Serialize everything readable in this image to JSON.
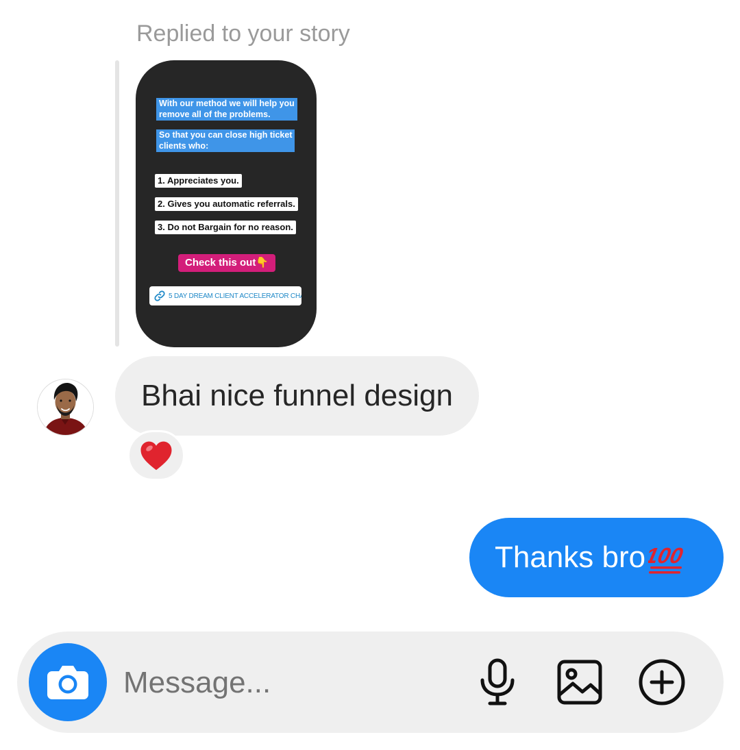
{
  "reply_header": {
    "label": "Replied to your story"
  },
  "story": {
    "highlight_1": [
      "With our method we will help you",
      "remove all of the problems."
    ],
    "highlight_2": [
      "So that you can close high ticket",
      "clients who:"
    ],
    "list": [
      "1. Appreciates you.",
      "2. Gives you automatic referrals.",
      "3. Do not Bargain for no reason."
    ],
    "cta": "Check this out👇",
    "link_text": "5 DAY DREAM CLIENT ACCELERATOR CHA..."
  },
  "incoming_message": {
    "text": "Bhai nice funnel design",
    "reaction": "❤️"
  },
  "outgoing_message": {
    "text": "Thanks bro",
    "emoji": "💯"
  },
  "composer": {
    "placeholder": "Message...",
    "camera_icon": "camera-icon",
    "mic_icon": "microphone-icon",
    "gallery_icon": "image-icon",
    "plus_icon": "plus-circle-icon"
  },
  "colors": {
    "primary_blue": "#1a86f5",
    "bubble_gray": "#efefef",
    "story_bg": "#262626",
    "highlight_blue": "#3f95e8",
    "cta_pink": "#d31e7a",
    "reaction_red": "#e0242e"
  }
}
